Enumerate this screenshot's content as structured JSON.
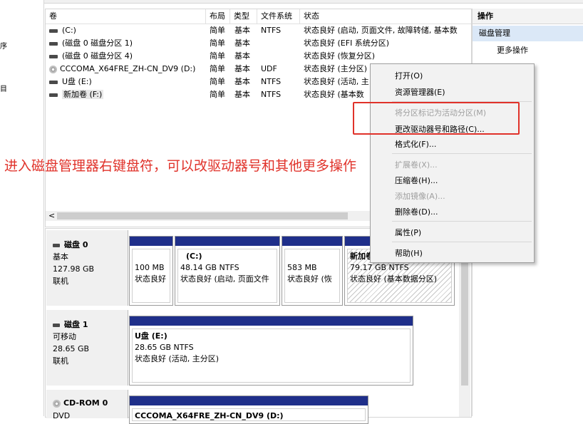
{
  "leftnav": {
    "frag1": "序",
    "frag2": "目"
  },
  "columns": {
    "volume": "卷",
    "layout": "布局",
    "type": "类型",
    "fs": "文件系统",
    "status": "状态"
  },
  "volumes": [
    {
      "name": "(C:)",
      "layout": "简单",
      "type": "基本",
      "fs": "NTFS",
      "status": "状态良好 (启动, 页面文件, 故障转储, 基本数"
    },
    {
      "name": "(磁盘 0 磁盘分区 1)",
      "layout": "简单",
      "type": "基本",
      "fs": "",
      "status": "状态良好 (EFI 系统分区)"
    },
    {
      "name": "(磁盘 0 磁盘分区 4)",
      "layout": "简单",
      "type": "基本",
      "fs": "",
      "status": "状态良好 (恢复分区)"
    },
    {
      "name": "CCCOMA_X64FRE_ZH-CN_DV9 (D:)",
      "layout": "简单",
      "type": "基本",
      "fs": "UDF",
      "status": "状态良好 (主分区)"
    },
    {
      "name": "U盘 (E:)",
      "layout": "简单",
      "type": "基本",
      "fs": "NTFS",
      "status": "状态良好 (活动, 主"
    },
    {
      "name": "新加卷 (F:)",
      "layout": "简单",
      "type": "基本",
      "fs": "NTFS",
      "status": "状态良好 (基本数"
    }
  ],
  "scroll_left_arrow": "<",
  "disks": [
    {
      "title": "磁盘 0",
      "kind": "基本",
      "size": "127.98 GB",
      "state": "联机"
    },
    {
      "title": "磁盘 1",
      "kind": "可移动",
      "size": "28.65 GB",
      "state": "联机"
    },
    {
      "title": "CD-ROM 0",
      "kind": "DVD",
      "size": "",
      "state": ""
    }
  ],
  "partitions": {
    "d0p1": {
      "line1": "",
      "line2": "100 MB",
      "line3": "状态良好"
    },
    "d0p2": {
      "line1": "(C:)",
      "line2": "48.14 GB NTFS",
      "line3": "状态良好 (启动, 页面文件"
    },
    "d0p3": {
      "line1": "",
      "line2": "583 MB",
      "line3": "状态良好 (恢"
    },
    "d0p4": {
      "line1": "新加卷",
      "line2": "79.17 GB NTFS",
      "line3": "状态良好 (基本数据分区)"
    },
    "d1p1": {
      "line1": "U盘 (E:)",
      "line2": "28.65 GB NTFS",
      "line3": "状态良好 (活动, 主分区)"
    },
    "cd0": {
      "line1": "CCCOMA_X64FRE_ZH-CN_DV9 (D:)"
    }
  },
  "actions": {
    "header": "操作",
    "section": "磁盘管理",
    "more": "更多操作"
  },
  "context_menu": {
    "open": "打开(O)",
    "explorer": "资源管理器(E)",
    "mark_active": "将分区标记为活动分区(M)",
    "change_letter": "更改驱动器号和路径(C)...",
    "format": "格式化(F)...",
    "extend": "扩展卷(X)...",
    "shrink": "压缩卷(H)...",
    "mirror": "添加镜像(A)...",
    "delete": "删除卷(D)...",
    "properties": "属性(P)",
    "help": "帮助(H)"
  },
  "annotation": "进入磁盘管理器右键盘符，可以改驱动器号和其他更多操作",
  "colors": {
    "partition_bar": "#1f2f8a",
    "annotation": "#e0322a",
    "selected_section": "#dbe8f7"
  }
}
